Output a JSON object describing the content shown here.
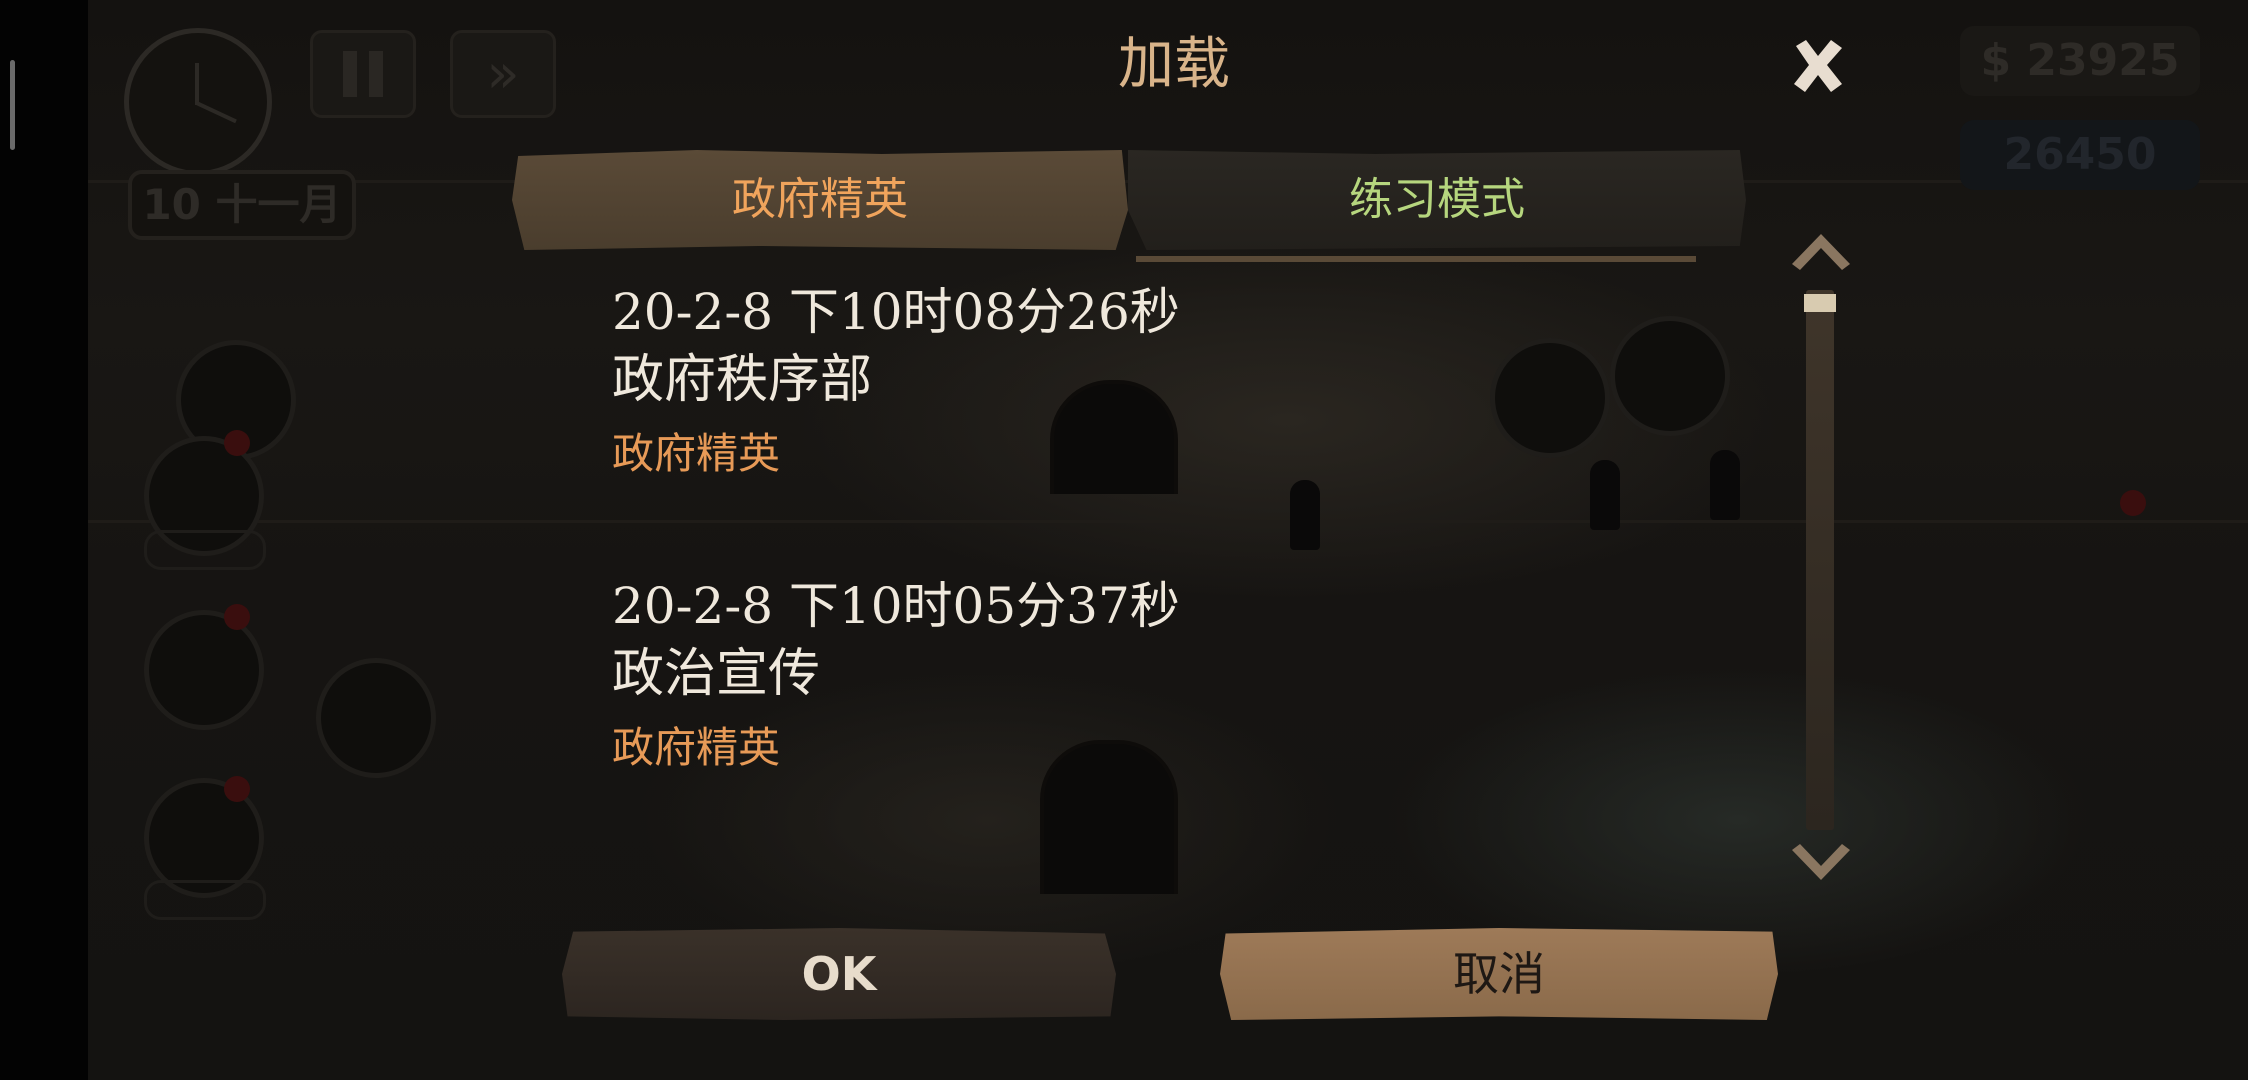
{
  "hud": {
    "date": "10 十一月",
    "money": "$ 23925",
    "coins": "26450"
  },
  "dialog": {
    "title": "加载",
    "tabs": [
      {
        "label": "政府精英",
        "selected": true
      },
      {
        "label": "练习模式",
        "selected": false
      }
    ],
    "saves": [
      {
        "timestamp": "20-2-8  下10时08分26秒",
        "name": "政府秩序部",
        "mode": "政府精英"
      },
      {
        "timestamp": "20-2-8  下10时05分37秒",
        "name": "政治宣传",
        "mode": "政府精英"
      }
    ],
    "ok_label": "OK",
    "cancel_label": "取消"
  },
  "colors": {
    "title": "#d9b48a",
    "tab_selected_text": "#f0a45c",
    "tab_unselected_text": "#b6d67e",
    "mode_text": "#e79a57",
    "cancel_button_bg": "#9e7a58"
  },
  "icons": {
    "close": "close-icon",
    "scroll_up": "chevron-up-icon",
    "scroll_down": "chevron-down-icon"
  }
}
